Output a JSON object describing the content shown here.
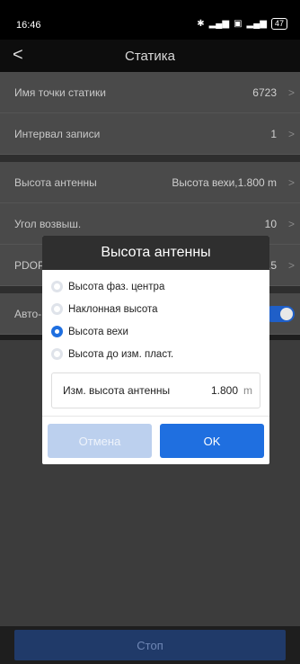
{
  "status_bar": {
    "time": "16:46",
    "battery": "47"
  },
  "header": {
    "title": "Статика",
    "back_icon": "chevron-left-icon"
  },
  "rows": {
    "point_name": {
      "label": "Имя точки статики",
      "value": "6723"
    },
    "interval": {
      "label": "Интервал записи",
      "value": "1"
    },
    "antenna_height": {
      "label": "Высота антенны",
      "value": "Высота вехи,1.800 m"
    },
    "elevation_angle": {
      "label": "Угол возвыш.",
      "value": "10"
    },
    "pdop": {
      "label": "PDOP",
      "value": "3.5"
    },
    "auto": {
      "label": "Авто-",
      "toggle_on": true
    }
  },
  "dialog": {
    "title": "Высота антенны",
    "options": [
      {
        "label": "Высота фаз. центра",
        "selected": false
      },
      {
        "label": "Наклонная высота",
        "selected": false
      },
      {
        "label": "Высота вехи",
        "selected": true
      },
      {
        "label": "Высота до изм. пласт.",
        "selected": false
      }
    ],
    "field": {
      "label": "Изм. высота антенны",
      "value": "1.800",
      "unit": "m"
    },
    "cancel_label": "Отмена",
    "ok_label": "OK"
  },
  "footer": {
    "stop_label": "Стоп"
  },
  "colors": {
    "accent": "#1f6fe0",
    "dialog_header": "#2f2f2f",
    "background": "#4a4a4a"
  }
}
